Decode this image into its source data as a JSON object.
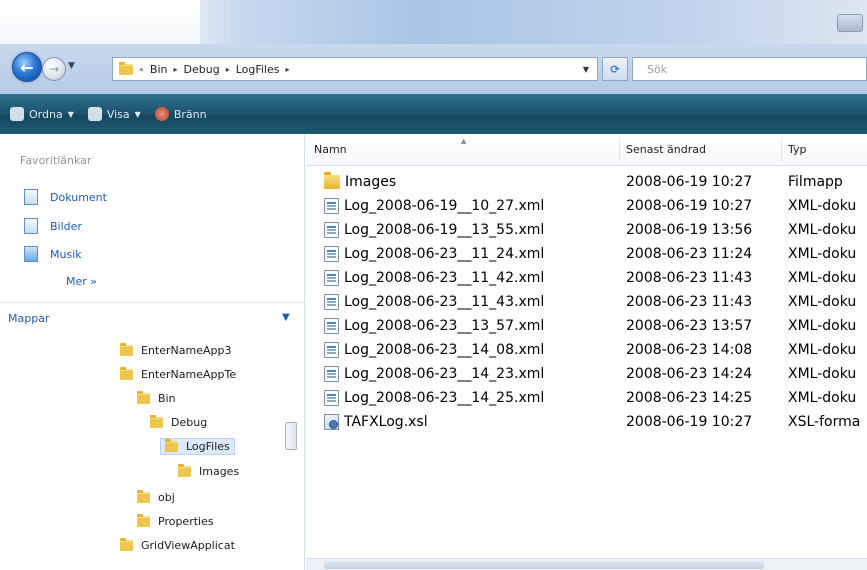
{
  "address": {
    "crumbs": [
      "Bin",
      "Debug",
      "LogFiles"
    ],
    "search_placeholder": "Sök"
  },
  "toolbar": {
    "organize_label": "Ordna",
    "views_label": "Visa",
    "burn_label": "Bränn"
  },
  "nav": {
    "favorites_title": "Favoritlänkar",
    "favorites": [
      "Dokument",
      "Bilder",
      "Musik"
    ],
    "more_label": "Mer »",
    "folders_title": "Mappar",
    "tree": [
      {
        "label": "EnterNameApp3",
        "selected": false
      },
      {
        "label": "EnterNameAppTe",
        "selected": false
      },
      {
        "label": "Bin",
        "selected": false
      },
      {
        "label": "Debug",
        "selected": false
      },
      {
        "label": "LogFiles",
        "selected": true
      },
      {
        "label": "Images",
        "selected": false
      },
      {
        "label": "obj",
        "selected": false
      },
      {
        "label": "Properties",
        "selected": false
      },
      {
        "label": "GridViewApplicat",
        "selected": false
      }
    ]
  },
  "files": {
    "columns": {
      "name": "Namn",
      "date": "Senast ändrad",
      "type": "Typ"
    },
    "rows": [
      {
        "icon": "folder-icon",
        "name": "Images",
        "date": "2008-06-19 10:27",
        "type": "Filmapp"
      },
      {
        "icon": "xml-file-icon",
        "name": "Log_2008-06-19__10_27.xml",
        "date": "2008-06-19 10:27",
        "type": "XML-doku"
      },
      {
        "icon": "xml-file-icon",
        "name": "Log_2008-06-19__13_55.xml",
        "date": "2008-06-19 13:56",
        "type": "XML-doku"
      },
      {
        "icon": "xml-file-icon",
        "name": "Log_2008-06-23__11_24.xml",
        "date": "2008-06-23 11:24",
        "type": "XML-doku"
      },
      {
        "icon": "xml-file-icon",
        "name": "Log_2008-06-23__11_42.xml",
        "date": "2008-06-23 11:43",
        "type": "XML-doku"
      },
      {
        "icon": "xml-file-icon",
        "name": "Log_2008-06-23__11_43.xml",
        "date": "2008-06-23 11:43",
        "type": "XML-doku"
      },
      {
        "icon": "xml-file-icon",
        "name": "Log_2008-06-23__13_57.xml",
        "date": "2008-06-23 13:57",
        "type": "XML-doku"
      },
      {
        "icon": "xml-file-icon",
        "name": "Log_2008-06-23__14_08.xml",
        "date": "2008-06-23 14:08",
        "type": "XML-doku"
      },
      {
        "icon": "xml-file-icon",
        "name": "Log_2008-06-23__14_23.xml",
        "date": "2008-06-23 14:24",
        "type": "XML-doku"
      },
      {
        "icon": "xml-file-icon",
        "name": "Log_2008-06-23__14_25.xml",
        "date": "2008-06-23 14:25",
        "type": "XML-doku"
      },
      {
        "icon": "xsl-file-icon",
        "name": "TAFXLog.xsl",
        "date": "2008-06-19 10:27",
        "type": "XSL-forma"
      }
    ]
  }
}
